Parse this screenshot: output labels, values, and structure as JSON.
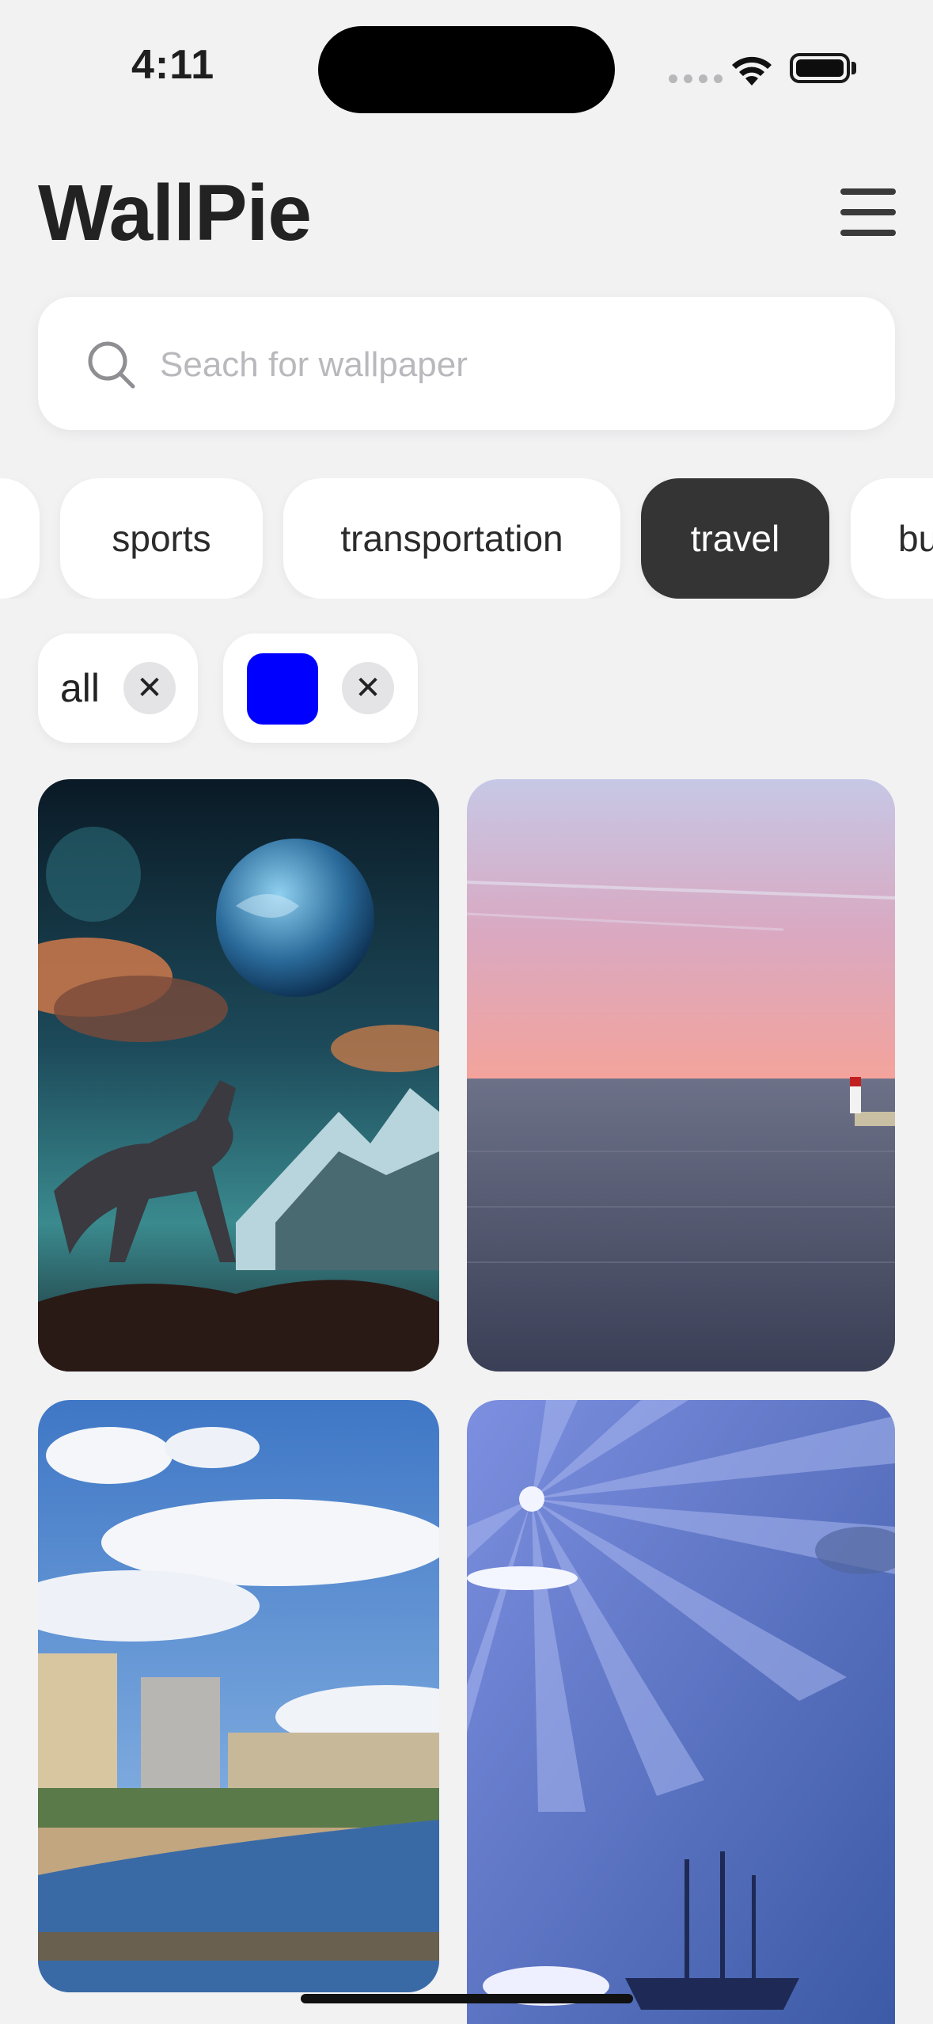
{
  "status_bar": {
    "time": "4:11"
  },
  "app": {
    "title": "WallPie"
  },
  "search": {
    "placeholder": "Seach for wallpaper"
  },
  "categories": [
    {
      "label": "",
      "active": false
    },
    {
      "label": "sports",
      "active": false
    },
    {
      "label": "transportation",
      "active": false
    },
    {
      "label": "travel",
      "active": true
    },
    {
      "label": "bu",
      "active": false
    }
  ],
  "filters": {
    "category": {
      "label": "all"
    },
    "color": {
      "value": "#0000ff"
    }
  },
  "wallpapers": [
    {
      "name": "wolf-moon"
    },
    {
      "name": "sea-lighthouse"
    },
    {
      "name": "beach-city"
    },
    {
      "name": "sunburst-ship"
    }
  ],
  "colors": {
    "background": "#f2f2f3",
    "chip_active": "#343434",
    "filter_color": "#0000ff"
  }
}
